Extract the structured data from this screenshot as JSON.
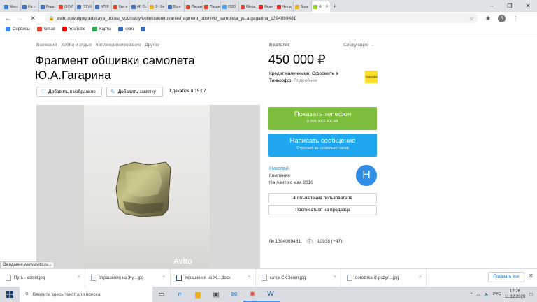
{
  "browser": {
    "tabs": [
      {
        "label": "Месс",
        "color": "#2d7ad6"
      },
      {
        "label": "На ст",
        "color": "#3b6fb6"
      },
      {
        "label": "Реда",
        "color": "#3b6fb6"
      },
      {
        "label": "(19) Г",
        "color": "#e63c2f"
      },
      {
        "label": "(12) Il",
        "color": "#3b6fb6"
      },
      {
        "label": "ЧП В",
        "color": "#3b6fb6"
      },
      {
        "label": "Где в",
        "color": "#d9442a"
      },
      {
        "label": "(4) Сс",
        "color": "#3b6fb6"
      },
      {
        "label": "3 · Вн",
        "color": "#e8b21a"
      },
      {
        "label": "Волг",
        "color": "#3b6fb6"
      },
      {
        "label": "Письм",
        "color": "#d9442a"
      },
      {
        "label": "Письм",
        "color": "#d9442a"
      },
      {
        "label": "2020",
        "color": "#4aa3f0"
      },
      {
        "label": "Globa",
        "color": "#db4437"
      },
      {
        "label": "Янде",
        "color": "#e62828"
      },
      {
        "label": "Что д",
        "color": "#e62828"
      },
      {
        "label": "Волг",
        "color": "#e8b21a"
      },
      {
        "label": "Ф",
        "color": "#97cf26"
      }
    ],
    "url": "avito.ru/volgogradskaya_oblast_volzhskiy/kollektsionirovanie/fragment_obshivki_samoleta_yu.a.gagarina_1394089481",
    "profile_initial": "К",
    "bookmarks": [
      {
        "label": "Сервисы",
        "color": "#4285f4"
      },
      {
        "label": "Gmail",
        "color": "#ea4335"
      },
      {
        "label": "YouTube",
        "color": "#ff0000"
      },
      {
        "label": "Карты",
        "color": "#34a853"
      },
      {
        "label": "олго",
        "color": "#3b6fb6"
      },
      {
        "label": "",
        "color": "#3b6fb6"
      }
    ]
  },
  "listing": {
    "breadcrumbs": "Волжский · Хобби и отдых · Коллекционирование · Другое",
    "title": "Фрагмент обшивки самолета Ю.А.Гагарина",
    "favorite_label": "Добавить в избранное",
    "note_label": "Добавить заметку",
    "date": "3 декабря в 15:07",
    "watermark": "Avito"
  },
  "sidebar": {
    "catalog_link": "В каталог",
    "next_link": "Следующее →",
    "price": "450 000 ₽",
    "credit_text": "Кредит наличными. Оформить в Тинькофф.",
    "credit_more": "Подробнее",
    "credit_logo": "Тинькофф",
    "phone_button": "Показать телефон",
    "phone_masked": "8 995 XXX-XX-XX",
    "message_button": "Написать сообщение",
    "message_sub": "Отвечает за несколько часов",
    "seller_name": "Николай",
    "seller_type": "Компания",
    "seller_since": "На Авито с мая 2016",
    "seller_initial": "Н",
    "ads_button": "4 объявления пользователя",
    "subscribe_button": "Подписаться на продавца",
    "listing_number": "№ 1394089481,",
    "views": "10938 (+47)"
  },
  "status_bar": "Ожидание www.avito.ru...",
  "downloads": [
    "Путь - копия.jpg",
    "Украшения на Жу....jpg",
    "Украшения на Ж....docx",
    "каток СК Зенит.jpg",
    "dorozhka-iz-puzyr....jpg"
  ],
  "show_all": "Показать все",
  "taskbar": {
    "search_placeholder": "Введите здесь текст для поиска",
    "lang": "РУС",
    "time": "12:26",
    "date": "11.12.2020"
  }
}
